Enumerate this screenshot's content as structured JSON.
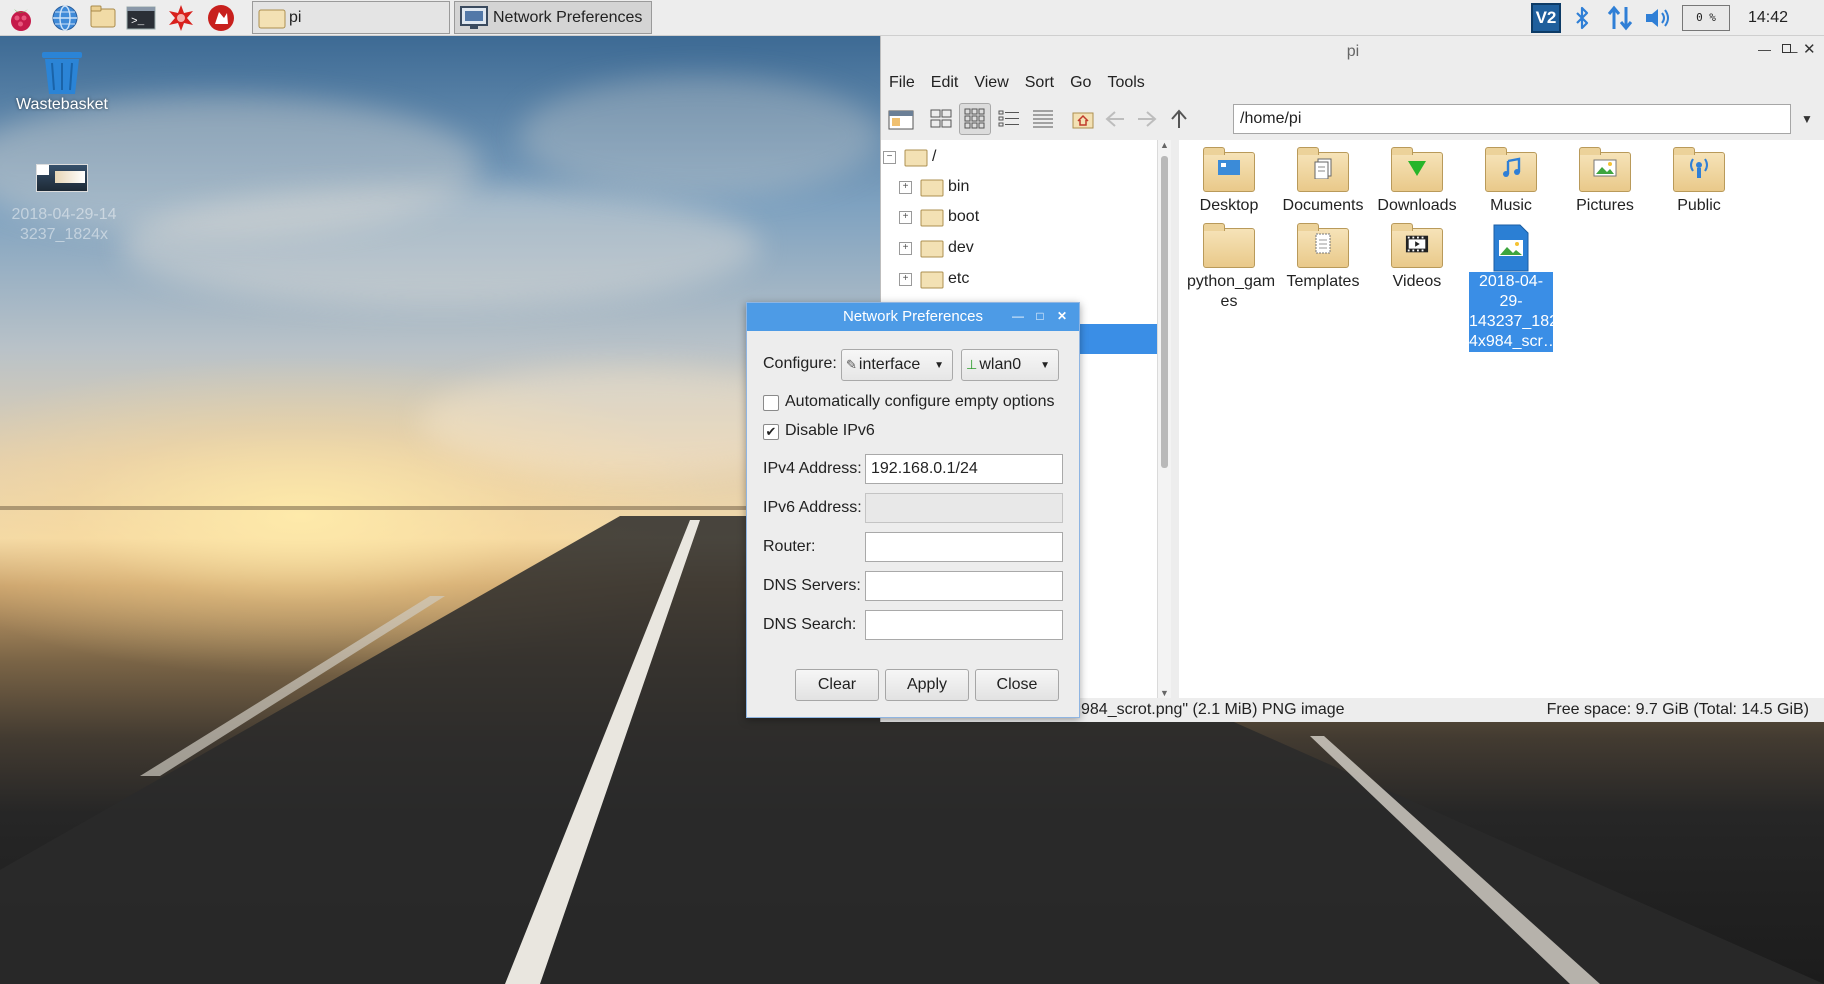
{
  "taskbar": {
    "tasks": [
      {
        "label": "pi"
      },
      {
        "label": "Network Preferences"
      }
    ],
    "tray": {
      "vnc": "V2",
      "cpu": "0 %",
      "clock": "14:42"
    }
  },
  "desktop": {
    "icons": [
      {
        "label": "Wastebasket"
      },
      {
        "label": "2018-04-29-14\n3237_1824x"
      }
    ]
  },
  "file_manager": {
    "title": "pi",
    "menu": [
      "File",
      "Edit",
      "View",
      "Sort",
      "Go",
      "Tools"
    ],
    "path": "/home/pi",
    "tree": [
      {
        "label": "/"
      },
      {
        "label": "bin"
      },
      {
        "label": "boot"
      },
      {
        "label": "dev"
      },
      {
        "label": "etc"
      }
    ],
    "files": [
      {
        "label": "Desktop"
      },
      {
        "label": "Documents"
      },
      {
        "label": "Downloads"
      },
      {
        "label": "Music"
      },
      {
        "label": "Pictures"
      },
      {
        "label": "Public"
      },
      {
        "label": "python_gam\nes"
      },
      {
        "label": "Templates"
      },
      {
        "label": "Videos"
      },
      {
        "label": "2018-04-29-\n143237_182\n4x984_scr…"
      }
    ],
    "status_left": "984_scrot.png\" (2.1 MiB) PNG image",
    "status_right": "Free space: 9.7 GiB (Total: 14.5 GiB)"
  },
  "network_dialog": {
    "title": "Network Preferences",
    "configure_label": "Configure:",
    "configure_type": "interface",
    "configure_iface": "wlan0",
    "auto_configure_label": "Automatically configure empty options",
    "auto_configure_checked": false,
    "disable_ipv6_label": "Disable IPv6",
    "disable_ipv6_checked": true,
    "fields": {
      "ipv4_label": "IPv4 Address:",
      "ipv4_value": "192.168.0.1/24",
      "ipv6_label": "IPv6 Address:",
      "ipv6_value": "",
      "router_label": "Router:",
      "router_value": "",
      "dns_servers_label": "DNS Servers:",
      "dns_servers_value": "",
      "dns_search_label": "DNS Search:",
      "dns_search_value": ""
    },
    "buttons": {
      "clear": "Clear",
      "apply": "Apply",
      "close": "Close"
    }
  },
  "colors": {
    "dialog_title": "#4d9be6",
    "selection": "#3a8ee6",
    "taskbar": "#ededed"
  }
}
